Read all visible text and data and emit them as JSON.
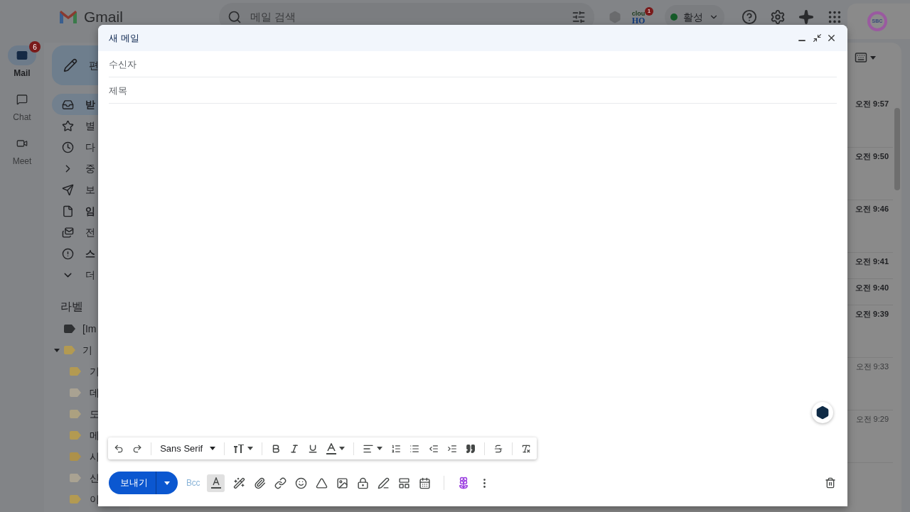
{
  "rail": [
    {
      "label": "Mail",
      "badge": "6",
      "selected": true
    },
    {
      "label": "Chat",
      "selected": false
    },
    {
      "label": "Meet",
      "selected": false
    }
  ],
  "topbar": {
    "logo": "Gmail",
    "search_placeholder": "메일 검색",
    "addon_logo": [
      "clou",
      "HO"
    ],
    "addon_badge": "1",
    "status": "활성",
    "avatar": "SBC"
  },
  "sidebar": {
    "compose": "편",
    "items": [
      {
        "label": "받",
        "selected": true,
        "unread": true
      },
      {
        "label": "별",
        "selected": false,
        "unread": false
      },
      {
        "label": "다",
        "selected": false,
        "unread": false
      },
      {
        "label": "중",
        "selected": false,
        "unread": false
      },
      {
        "label": "보",
        "selected": false,
        "unread": false
      },
      {
        "label": "임",
        "selected": false,
        "unread": true
      },
      {
        "label": "전",
        "selected": false,
        "unread": false
      },
      {
        "label": "스",
        "selected": false,
        "unread": true
      },
      {
        "label": "더",
        "selected": false,
        "unread": false
      }
    ],
    "labels_title": "라벨",
    "labels": [
      {
        "label": "[Im",
        "color": "#2f3133"
      },
      {
        "label": "기",
        "color": "#b39a52",
        "expanded": true,
        "children": [
          {
            "label": "기",
            "color": "#b39a52"
          },
          {
            "label": "데",
            "color": "#a9a292"
          },
          {
            "label": "도",
            "color": "#aca180"
          },
          {
            "label": "메",
            "color": "#b39a52"
          },
          {
            "label": "시",
            "color": "#ad914a"
          },
          {
            "label": "신",
            "color": "#a9a292"
          },
          {
            "label": "이",
            "color": "#b39a52"
          }
        ]
      }
    ]
  },
  "mail_times": [
    {
      "time": "오전 9:57",
      "unread": true
    },
    {
      "time": "오전 9:50",
      "unread": true
    },
    {
      "time": "오전 9:46",
      "unread": true
    },
    {
      "time": "오전 9:41",
      "unread": true
    },
    {
      "time": "오전 9:40",
      "unread": true
    },
    {
      "time": "오전 9:39",
      "unread": true
    },
    {
      "time": "오전 9:33",
      "unread": false
    },
    {
      "time": "오전 9:29",
      "unread": false
    }
  ],
  "compose": {
    "title": "새 메일",
    "to_placeholder": "수신자",
    "subject_placeholder": "제목",
    "font": "Sans Serif",
    "send": "보내기",
    "bcc": "Bcc",
    "formatting_on": true
  }
}
